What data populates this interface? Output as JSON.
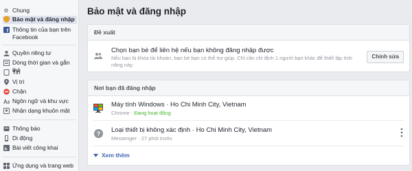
{
  "sidebar": {
    "items": [
      {
        "label": "Chung",
        "icon": "gear-icon"
      },
      {
        "label": "Bảo mật và đăng nhập",
        "icon": "shield-icon"
      },
      {
        "label": "Thông tin của bạn trên Facebook",
        "icon": "facebook-icon"
      },
      {
        "label": "Quyền riêng tư",
        "icon": "privacy-icon"
      },
      {
        "label": "Dòng thời gian và gắn thẻ",
        "icon": "timeline-icon"
      },
      {
        "label": "Tin",
        "icon": "stories-icon"
      },
      {
        "label": "Vị trí",
        "icon": "location-icon"
      },
      {
        "label": "Chặn",
        "icon": "block-icon"
      },
      {
        "label": "Ngôn ngữ và khu vực",
        "icon": "language-icon"
      },
      {
        "label": "Nhận dạng khuôn mặt",
        "icon": "face-icon"
      },
      {
        "label": "Thông báo",
        "icon": "notifications-icon"
      },
      {
        "label": "Di động",
        "icon": "mobile-icon"
      },
      {
        "label": "Bài viết công khai",
        "icon": "rss-icon"
      },
      {
        "label": "Ứng dụng và trang web",
        "icon": "apps-icon"
      }
    ]
  },
  "main": {
    "title": "Bảo mật và đăng nhập",
    "recommended": {
      "header": "Đề xuất",
      "title": "Chọn bạn bè để liên hệ nếu bạn không đăng nhập được",
      "description": "Nếu bạn bị khóa tài khoản, bạn bè bạn có thể trợ giúp. Chỉ cần chỉ định 1 người bạn khác để thiết lập tính năng này.",
      "button": "Chỉnh sửa"
    },
    "logged_in": {
      "header": "Nơi bạn đã đăng nhập",
      "sessions": [
        {
          "device": "Máy tính Windows · Ho Chi Minh City, Vietnam",
          "client": "Chrome",
          "sep": " · ",
          "status": "Đang hoạt động"
        },
        {
          "device": "Loại thiết bị không xác định · Ho Chi Minh City, Vietnam",
          "client": "Messenger",
          "sep": " · ",
          "status": "27 phút trước"
        }
      ],
      "see_more": "Xem thêm"
    }
  }
}
